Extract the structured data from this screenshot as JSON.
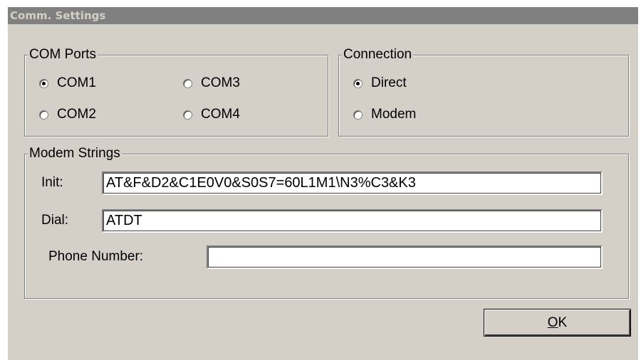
{
  "window": {
    "title": "Comm. Settings"
  },
  "com_ports": {
    "legend": "COM Ports",
    "options": [
      {
        "label": "COM1",
        "selected": true
      },
      {
        "label": "COM2",
        "selected": false
      },
      {
        "label": "COM3",
        "selected": false
      },
      {
        "label": "COM4",
        "selected": false
      }
    ]
  },
  "connection": {
    "legend": "Connection",
    "options": [
      {
        "label": "Direct",
        "selected": true
      },
      {
        "label": "Modem",
        "selected": false
      }
    ]
  },
  "modem_strings": {
    "legend": "Modem Strings",
    "init_label": "Init:",
    "init_value": "AT&F&D2&C1E0V0&S0S7=60L1M1\\N3%C3&K3",
    "dial_label": "Dial:",
    "dial_value": "ATDT",
    "phone_label": "Phone Number:",
    "phone_value": ""
  },
  "ok_button": {
    "mnemonic": "O",
    "rest": "K"
  }
}
